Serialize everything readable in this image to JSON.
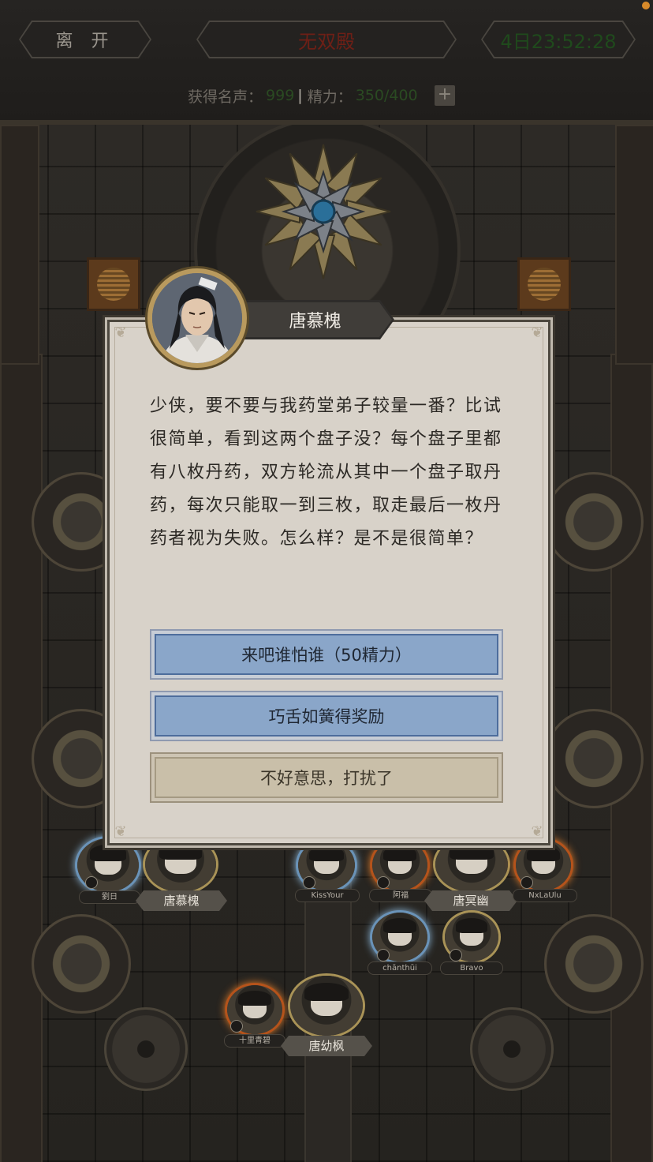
{
  "header": {
    "leave_label": "离 开",
    "title": "无双殿",
    "timer": "4日23:52:28",
    "fame_label": "获得名声：",
    "fame_value": "999",
    "separator": "|",
    "energy_label": "精力：",
    "energy_value": "350/400",
    "plus_label": "+"
  },
  "dialog": {
    "speaker": "唐慕槐",
    "text": "少侠，要不要与我药堂弟子较量一番？比试很简单，看到这两个盘子没？每个盘子里都有八枚丹药，双方轮流从其中一个盘子取丹药，每次只能取一到三枚，取走最后一枚丹药者视为失败。怎么样？是不是很简单？",
    "options": [
      "来吧谁怕谁（50精力）",
      "巧舌如簧得奖励",
      "不好意思，打扰了"
    ]
  },
  "players": [
    {
      "name": "劉日"
    },
    {
      "name": "唐慕槐"
    },
    {
      "name": "KissYour"
    },
    {
      "name": "阿福"
    },
    {
      "name": "唐冥幽"
    },
    {
      "name": "NxLaUlu"
    },
    {
      "name": "chānthūi"
    },
    {
      "name": "Bravo"
    },
    {
      "name": "十里青碧"
    },
    {
      "name": "唐幼枫"
    }
  ],
  "colors": {
    "accent_blue": "#8aa6c9",
    "title_red": "#6e1f16",
    "timer_green": "#1f4a1c"
  }
}
